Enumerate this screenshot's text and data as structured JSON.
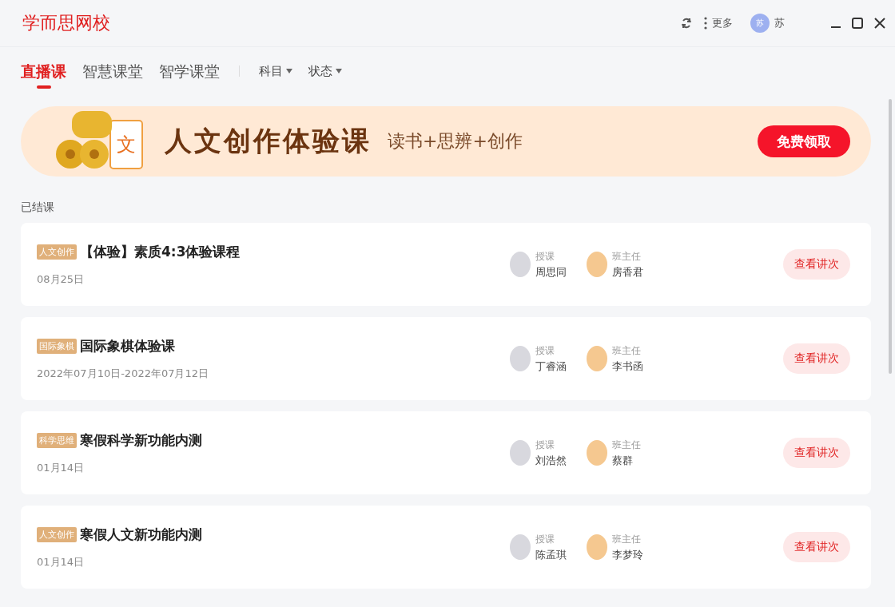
{
  "app": {
    "logo": "学而思网校",
    "more": "更多",
    "user_avatar": "苏",
    "user_name": "苏"
  },
  "tabs": [
    {
      "label": "直播课",
      "selected": true
    },
    {
      "label": "智慧课堂",
      "selected": false
    },
    {
      "label": "智学课堂",
      "selected": false
    }
  ],
  "filters": [
    "科目",
    "状态"
  ],
  "banner": {
    "icon_text": "文",
    "title": "人文创作体验课",
    "subtitle": "读书+思辨+创作",
    "button": "免费领取"
  },
  "section_label": "已结课",
  "courses": [
    {
      "tag": "人文创作",
      "title": "【体验】素质4:3体验课程",
      "date": "08月25日",
      "teacher_label": "授课",
      "teacher": "周思同",
      "head_label": "班主任",
      "head": "房香君",
      "button": "查看讲次"
    },
    {
      "tag": "国际象棋",
      "title": "国际象棋体验课",
      "date": "2022年07月10日-2022年07月12日",
      "teacher_label": "授课",
      "teacher": "丁睿涵",
      "head_label": "班主任",
      "head": "李书函",
      "button": "查看讲次"
    },
    {
      "tag": "科学思维",
      "title": "寒假科学新功能内测",
      "date": "01月14日",
      "teacher_label": "授课",
      "teacher": "刘浩然",
      "head_label": "班主任",
      "head": "蔡群",
      "button": "查看讲次"
    },
    {
      "tag": "人文创作",
      "title": "寒假人文新功能内测",
      "date": "01月14日",
      "teacher_label": "授课",
      "teacher": "陈孟琪",
      "head_label": "班主任",
      "head": "李梦玲",
      "button": "查看讲次"
    }
  ]
}
